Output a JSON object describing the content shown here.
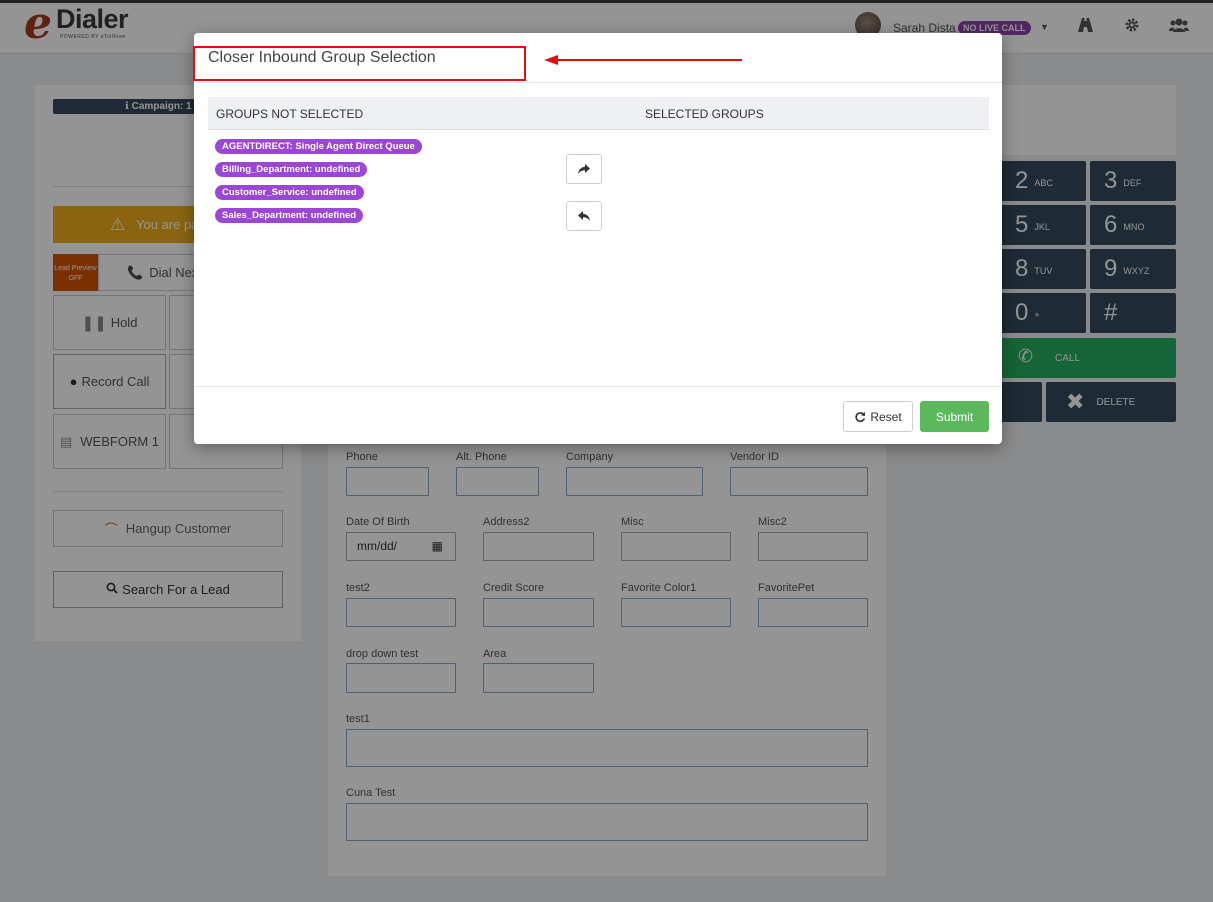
{
  "app": {
    "logo_e": "e",
    "logo_name": "Dialer",
    "logo_powered": "POWERED BY eTollFree"
  },
  "topbar": {
    "user_name": "Sarah Dista",
    "live_status": "NO LIVE CALL",
    "icons": [
      "road-icon",
      "gear-icon",
      "users-icon"
    ]
  },
  "left": {
    "campaign_label": "Campaign: 1",
    "pause_alert": "You are pa",
    "lead_preview_label": "Lead Preview",
    "lead_preview_state": "OFF",
    "dial_next": "Dial Nex",
    "hold": "Hold",
    "record_call": "Record Call",
    "webform1": "WEBFORM 1",
    "hangup": "Hangup Customer",
    "search_lead": "Search For a Lead"
  },
  "form": {
    "fields": {
      "phone": "Phone",
      "alt_phone": "Alt. Phone",
      "company": "Company",
      "vendor_id": "Vendor ID",
      "dob": "Date Of Birth",
      "dob_placeholder": "mm/dd/",
      "address2": "Address2",
      "misc": "Misc",
      "misc2": "Misc2",
      "test2": "test2",
      "credit_score": "Credit Score",
      "favorite_color": "Favorite Color1",
      "favorite_pet": "FavoritePet",
      "drop_down_test": "drop down test",
      "area": "Area",
      "test1": "test1",
      "cuna_test": "Cuna Test"
    }
  },
  "dialpad": {
    "keys": [
      {
        "digit": "2",
        "letters": "ABC"
      },
      {
        "digit": "3",
        "letters": "DEF"
      },
      {
        "digit": "5",
        "letters": "JKL"
      },
      {
        "digit": "6",
        "letters": "MNO"
      },
      {
        "digit": "8",
        "letters": "TUV"
      },
      {
        "digit": "9",
        "letters": "WXYZ"
      },
      {
        "digit": "0",
        "letters": "+"
      },
      {
        "digit": "#",
        "letters": ""
      }
    ],
    "call": "CALL",
    "delete": "DELETE"
  },
  "modal": {
    "title": "Closer Inbound Group Selection",
    "col_not_selected": "GROUPS NOT SELECTED",
    "col_selected": "SELECTED GROUPS",
    "groups_not_selected": [
      "AGENTDIRECT: Single Agent Direct Queue",
      "Billing_Department: undefined",
      "Customer_Service: undefined",
      "Sales_Department: undefined"
    ],
    "reset": "Reset",
    "submit": "Submit",
    "highlight_color": "#e01010",
    "pill_color": "#9b46d6",
    "submit_color": "#5cb85c"
  }
}
